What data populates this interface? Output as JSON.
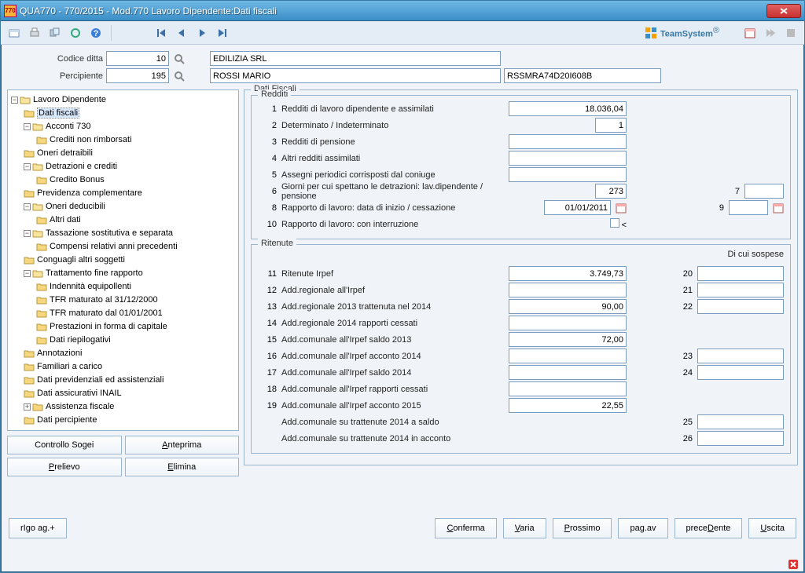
{
  "window": {
    "title": "QUA770  -  770/2015  -  Mod.770 Lavoro Dipendente:Dati fiscali",
    "logo_text": "TeamSystem"
  },
  "header": {
    "codice_ditta_label": "Codice ditta",
    "codice_ditta_value": "10",
    "codice_ditta_name": "EDILIZIA SRL",
    "percipiente_label": "Percipiente",
    "percipiente_value": "195",
    "percipiente_name": "ROSSI MARIO",
    "percipiente_cf": "RSSMRA74D20I608B"
  },
  "tree": {
    "root": "Lavoro Dipendente",
    "items": [
      "Dati fiscali",
      "Acconti 730",
      "Crediti non rimborsati",
      "Oneri detraibili",
      "Detrazioni e crediti",
      "Credito Bonus",
      "Previdenza complementare",
      "Oneri deducibili",
      "Altri dati",
      "Tassazione sostitutiva e separata",
      "Compensi relativi anni precedenti",
      "Conguagli altri soggetti",
      "Trattamento fine rapporto",
      "Indennità equipollenti",
      "TFR maturato al 31/12/2000",
      "TFR maturato dal 01/01/2001",
      "Prestazioni in forma di capitale",
      "Dati riepilogativi",
      "Annotazioni",
      "Familiari a carico",
      "Dati previdenziali ed assistenziali",
      "Dati assicurativi INAIL",
      "Assistenza fiscale",
      "Dati percipiente"
    ]
  },
  "tree_buttons": {
    "controllo": "Controllo Sogei",
    "anteprima": "nteprima",
    "anteprima_key": "A",
    "prelievo": "relievo",
    "prelievo_key": "P",
    "elimina": "limina",
    "elimina_key": "E"
  },
  "fiscali": {
    "title": "Dati Fiscali",
    "redditi_title": "Redditi",
    "redditi": [
      {
        "n": "1",
        "label": "Redditi di lavoro dipendente e assimilati",
        "value": "18.036,04"
      },
      {
        "n": "2",
        "label": "Determinato / Indeterminato",
        "value": "1",
        "short": true
      },
      {
        "n": "3",
        "label": "Redditi di pensione",
        "value": ""
      },
      {
        "n": "4",
        "label": "Altri redditi assimilati",
        "value": ""
      },
      {
        "n": "5",
        "label": "Assegni periodici corrisposti dal coniuge",
        "value": ""
      },
      {
        "n": "6",
        "label": "Giorni per cui spettano le detrazioni: lav.dipendente / pensione",
        "value": "273",
        "short": true
      },
      {
        "n": "8",
        "label": "Rapporto di lavoro: data di inizio / cessazione",
        "value": "01/01/2011",
        "date": true
      },
      {
        "n": "10",
        "label": "Rapporto di lavoro: con interruzione",
        "chk": true
      }
    ],
    "redditi_side": [
      {
        "n": "7",
        "value": ""
      },
      {
        "n": "9",
        "value": "",
        "cal": true
      }
    ],
    "ritenute_title": "Ritenute",
    "ritenute_side_head": "Di cui sospese",
    "ritenute": [
      {
        "n": "11",
        "label": "Ritenute Irpef",
        "value": "3.749,73",
        "side": "20"
      },
      {
        "n": "12",
        "label": "Add.regionale all'Irpef",
        "value": "",
        "side": "21"
      },
      {
        "n": "13",
        "label": "Add.regionale 2013 trattenuta nel 2014",
        "value": "90,00",
        "side": "22"
      },
      {
        "n": "14",
        "label": "Add.regionale 2014 rapporti cessati",
        "value": ""
      },
      {
        "n": "15",
        "label": "Add.comunale all'Irpef saldo 2013",
        "value": "72,00"
      },
      {
        "n": "16",
        "label": "Add.comunale all'Irpef acconto 2014",
        "value": "",
        "side": "23"
      },
      {
        "n": "17",
        "label": "Add.comunale all'Irpef saldo 2014",
        "value": "",
        "side": "24"
      },
      {
        "n": "18",
        "label": "Add.comunale all'Irpef rapporti cessati",
        "value": ""
      },
      {
        "n": "19",
        "label": "Add.comunale all'Irpef acconto 2015",
        "value": "22,55"
      },
      {
        "n": "",
        "label": "Add.comunale su trattenute 2014 a saldo",
        "noinp": true,
        "side": "25"
      },
      {
        "n": "",
        "label": "Add.comunale su trattenute 2014 in acconto",
        "noinp": true,
        "side": "26"
      }
    ]
  },
  "bottom": {
    "rigo": "rIgo ag.+",
    "conferma": "onferma",
    "conferma_key": "C",
    "varia": "aria",
    "varia_key": "V",
    "prossimo": "rossimo",
    "prossimo_key": "P",
    "pagav": "pag.av",
    "precedente": "ente",
    "precedente_prefix": "prece",
    "precedente_key": "D",
    "uscita": "scita",
    "uscita_key": "U"
  }
}
